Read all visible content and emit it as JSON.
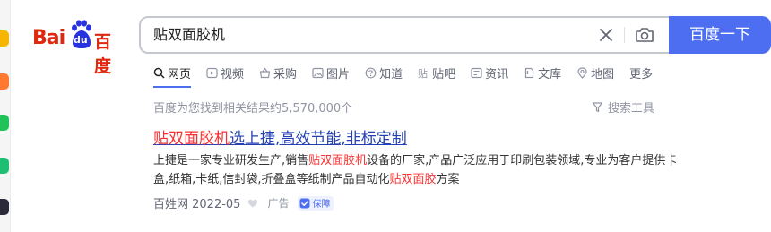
{
  "logo": {
    "text_bai": "Bai",
    "text_du": "du",
    "text_cn": "百度",
    "brand_red": "#de2910",
    "brand_blue": "#2932e1"
  },
  "search": {
    "value": "贴双面胶机",
    "button_label": "百度一下",
    "accent": "#4e6ef2"
  },
  "tabs": [
    {
      "label": "网页",
      "icon": "search-icon",
      "active": true
    },
    {
      "label": "视频",
      "icon": "play-icon"
    },
    {
      "label": "采购",
      "icon": "basket-icon"
    },
    {
      "label": "图片",
      "icon": "image-icon"
    },
    {
      "label": "知道",
      "icon": "question-icon"
    },
    {
      "label": "贴吧",
      "icon": "tieba-icon"
    },
    {
      "label": "资讯",
      "icon": "news-icon"
    },
    {
      "label": "文库",
      "icon": "doc-icon"
    },
    {
      "label": "地图",
      "icon": "map-pin-icon"
    },
    {
      "label": "更多",
      "icon": ""
    }
  ],
  "stats": {
    "text": "百度为您找到相关结果约5,570,000个",
    "tools_label": "搜索工具"
  },
  "result": {
    "title_highlight": "贴双面胶机",
    "title_rest": "选上捷,高效节能,非标定制",
    "snippet_parts": [
      "上捷是一家专业研发生产,销售",
      "贴双面胶机",
      "设备的厂家,产品广泛应用于印刷包装领域,专业为客户提供卡盒,纸箱,卡纸,信封袋,折叠盒等纸制产品自动化",
      "贴双面胶",
      "方案"
    ],
    "source": "百姓网 2022-05",
    "ad_label": "广告",
    "badge_label": "保障",
    "highlight_color": "#f73131"
  }
}
